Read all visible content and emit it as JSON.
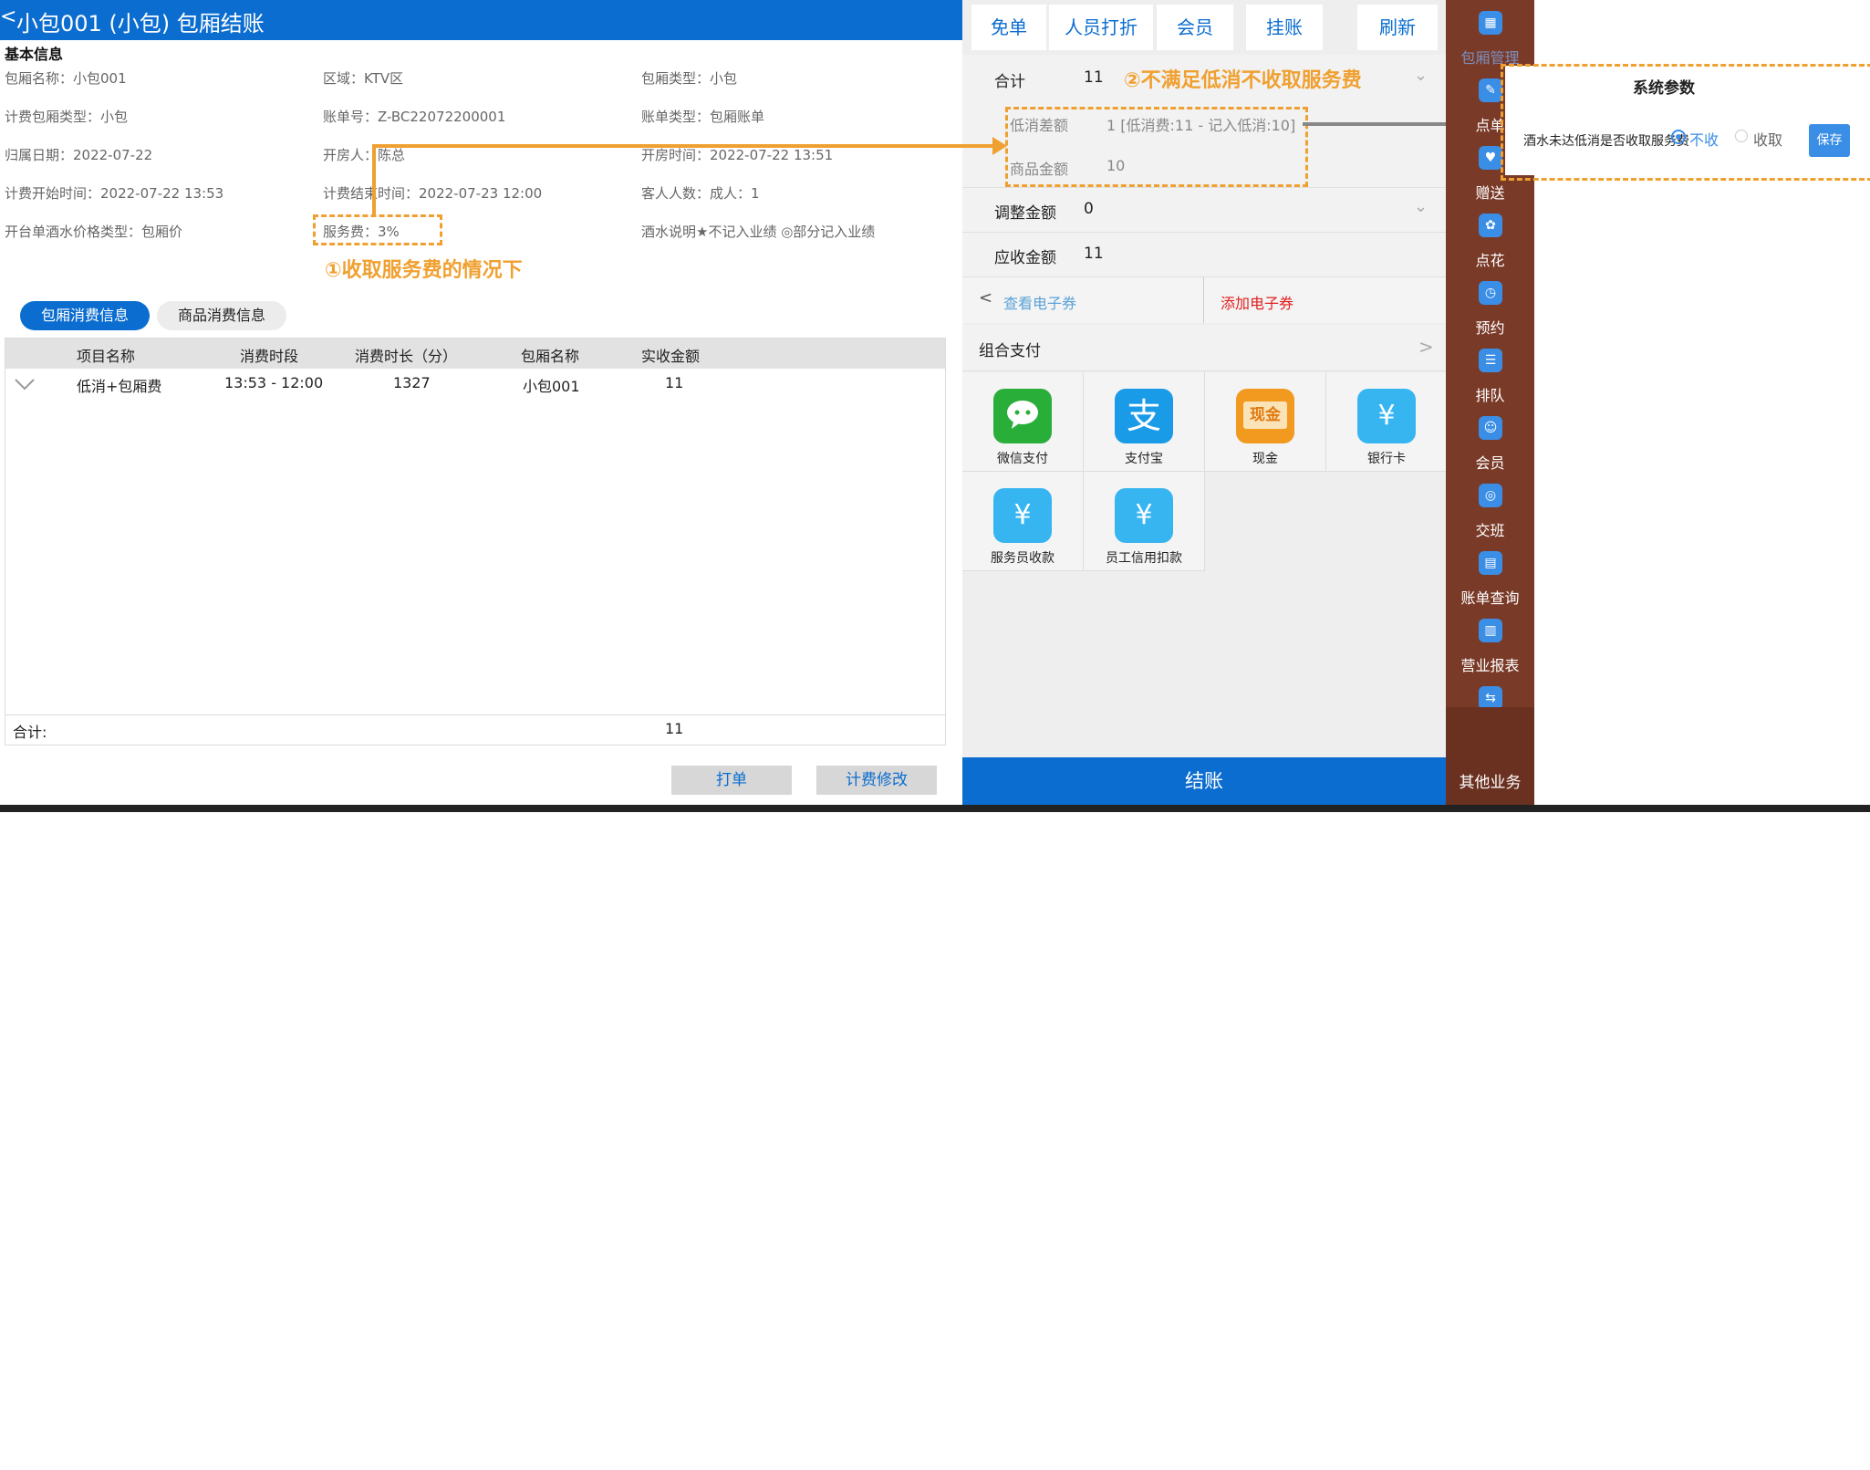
{
  "header": {
    "back": "<",
    "title": "小包001 (小包) 包厢结账"
  },
  "basic_info": {
    "section_title": "基本信息",
    "fields": [
      "包厢名称：小包001",
      "区域：KTV区",
      "包厢类型：小包",
      "计费包厢类型：小包",
      "账单号：Z-BC22072200001",
      "账单类型：包厢账单",
      "归属日期：2022-07-22",
      "开房人：陈总",
      "开房时间：2022-07-22 13:51",
      "计费开始时间：2022-07-22 13:53",
      "计费结束时间：2022-07-23 12:00",
      "客人人数：成人：1",
      "开台单酒水价格类型：包厢价",
      "服务费：3%",
      "酒水说明★不记入业绩 ◎部分记入业绩"
    ]
  },
  "annotations": {
    "a1": "①收取服务费的情况下",
    "a2": "②不满足低消不收取服务费"
  },
  "tabs": [
    "包厢消费信息",
    "商品消费信息"
  ],
  "table": {
    "headers": [
      "项目名称",
      "消费时段",
      "消费时长（分）",
      "包厢名称",
      "实收金额"
    ],
    "rows": [
      [
        "低消+包厢费",
        "13:53 - 12:00",
        "1327",
        "小包001",
        "11"
      ]
    ],
    "footer_label": "合计:",
    "footer_value": "11"
  },
  "bottom_buttons": [
    "打单",
    "计费修改"
  ],
  "top_buttons": [
    "免单",
    "人员打折",
    "会员",
    "挂账",
    "刷新"
  ],
  "summary": {
    "total_label": "合计",
    "total_value": "11",
    "diff_label": "低消差额",
    "diff_value": "1 [低消费:11 - 记入低消:10]",
    "goods_label": "商品金额",
    "goods_value": "10",
    "adjust_label": "调整金额",
    "adjust_value": "0",
    "receivable_label": "应收金额",
    "receivable_value": "11"
  },
  "coupon": {
    "view": "查看电子券",
    "add": "添加电子券"
  },
  "combo_pay": "组合支付",
  "payments": [
    {
      "label": "微信支付",
      "icon": "wechat-pay-icon",
      "color": "#2aae3a",
      "glyph": "微信支付"
    },
    {
      "label": "支付宝",
      "icon": "alipay-icon",
      "color": "#1a9be8",
      "glyph": "支"
    },
    {
      "label": "现金",
      "icon": "cash-icon",
      "color": "#f29a1f",
      "glyph": "现金"
    },
    {
      "label": "银行卡",
      "icon": "bank-card-icon",
      "color": "#37b5f0",
      "glyph": "¥"
    },
    {
      "label": "服务员收款",
      "icon": "waiter-collect-icon",
      "color": "#37b5f0",
      "glyph": "¥"
    },
    {
      "label": "员工信用扣款",
      "icon": "staff-credit-icon",
      "color": "#37b5f0",
      "glyph": "¥"
    }
  ],
  "checkout": "结账",
  "sidebar": {
    "items": [
      "包厢管理",
      "点单",
      "赠送",
      "点花",
      "预约",
      "排队",
      "会员",
      "交班",
      "账单查询",
      "营业报表",
      ""
    ],
    "more": "其他业务"
  },
  "popup": {
    "title": "系统参数",
    "question": "酒水未达低消是否收取服务费",
    "option_no": "不收",
    "option_yes": "收取",
    "save": "保存"
  },
  "colors": {
    "primary": "#0b6dcf",
    "annotation": "#f0a030",
    "sidebar": "#7a3a28"
  }
}
